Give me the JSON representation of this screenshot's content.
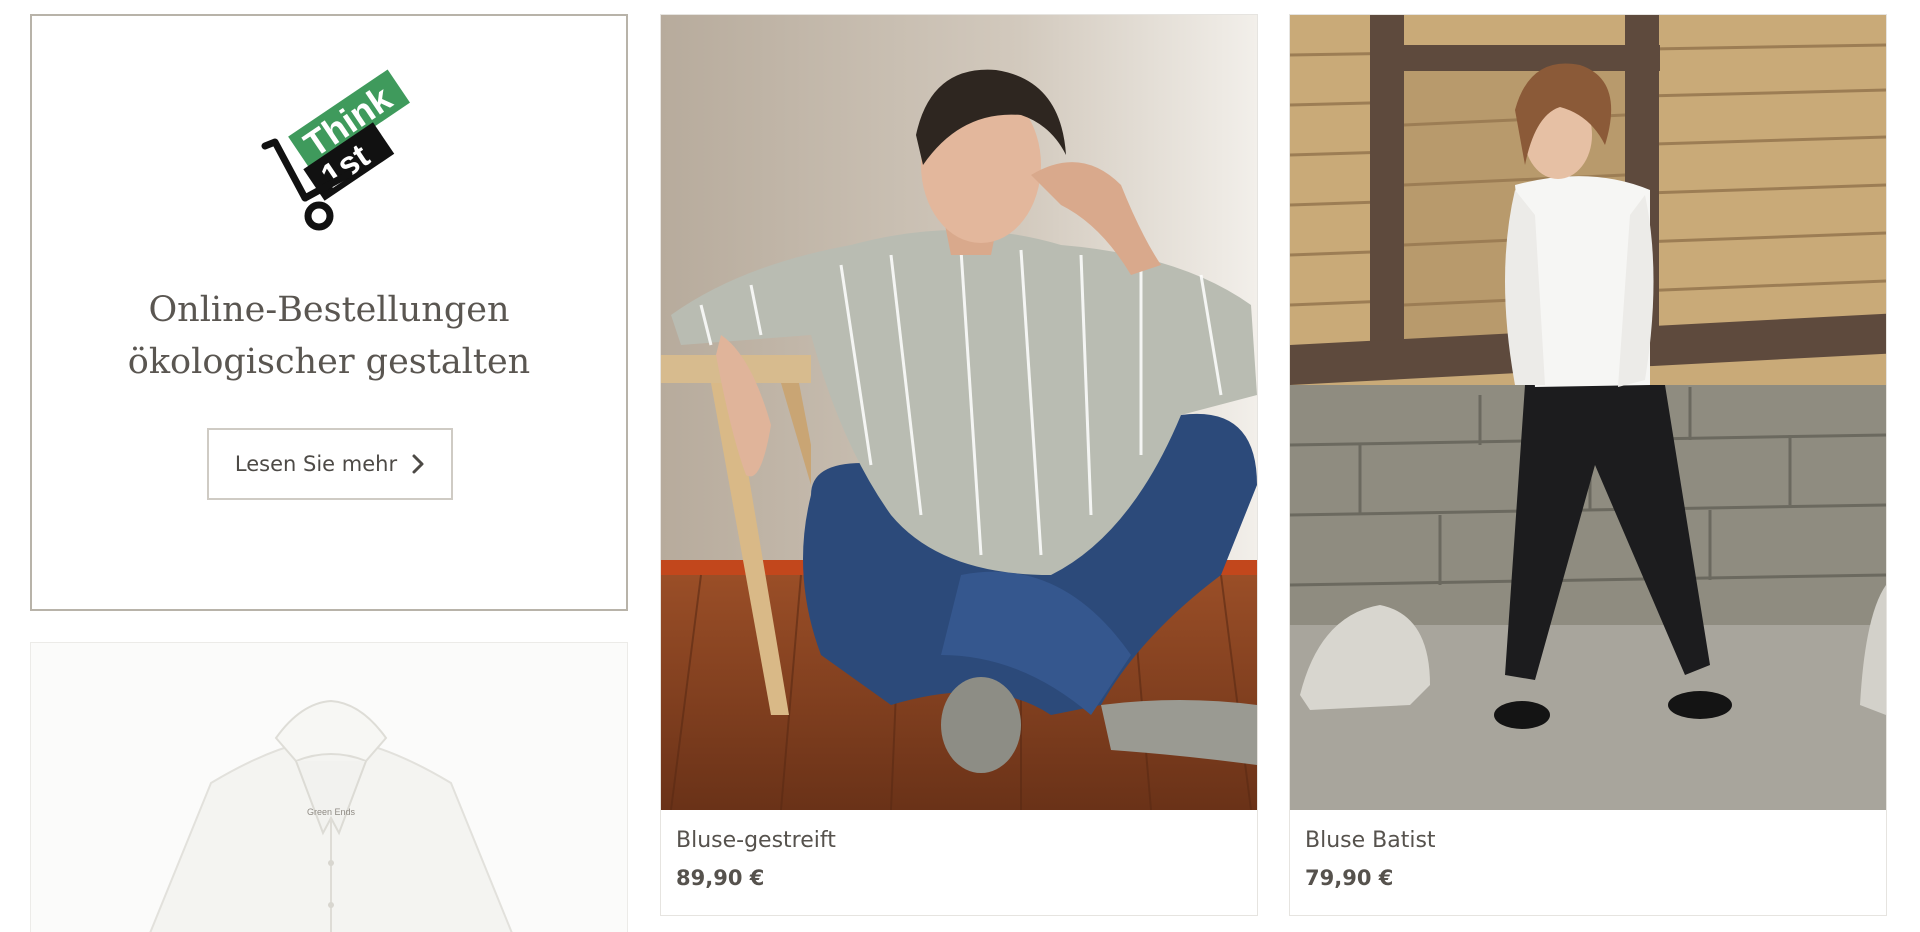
{
  "promo": {
    "logo_text_top": "Think",
    "logo_text_bottom": "1st",
    "heading_line1": "Online-Bestellungen",
    "heading_line2": "ökologischer gestalten",
    "button_label": "Lesen Sie mehr",
    "button_icon": "chevron-right-icon"
  },
  "products": [
    {
      "name": "Bluse-gestreift",
      "price": "89,90 €",
      "image": "woman-in-striped-blouse-sitting-on-wooden-floor"
    },
    {
      "name": "Bluse Batist",
      "price": "79,90 €",
      "image": "woman-in-white-batiste-blouse-walking-by-wooden-wall"
    }
  ],
  "bottom_card": {
    "image": "white-polo-shirt",
    "label_brand": "Green Ends"
  },
  "colors": {
    "logo_green": "#3f9a5c",
    "border": "#b8b3a9",
    "text": "#56524d"
  }
}
